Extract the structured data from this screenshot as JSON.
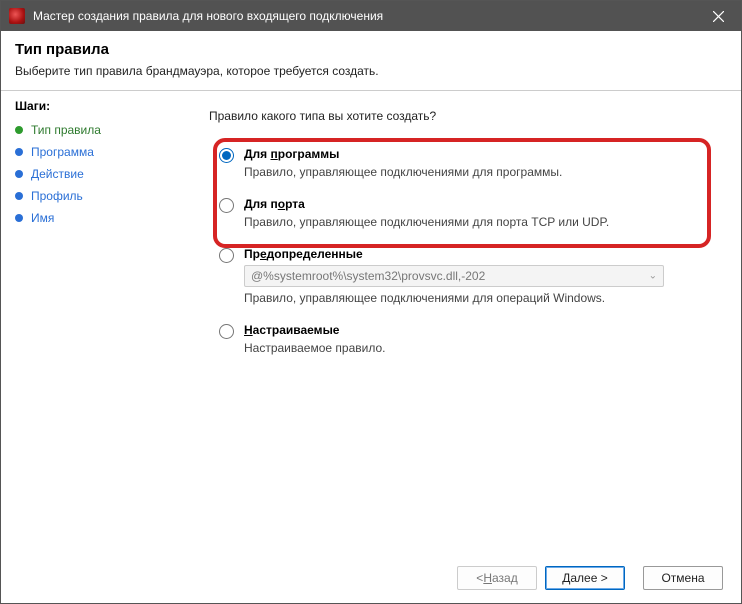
{
  "titlebar": {
    "title": "Мастер создания правила для нового входящего подключения"
  },
  "header": {
    "title": "Тип правила",
    "subtitle": "Выберите тип правила брандмауэра, которое требуется создать."
  },
  "steps": {
    "title": "Шаги:",
    "items": [
      {
        "label": "Тип правила",
        "color": "green",
        "active": true
      },
      {
        "label": "Программа",
        "color": "blue",
        "active": false
      },
      {
        "label": "Действие",
        "color": "blue",
        "active": false
      },
      {
        "label": "Профиль",
        "color": "blue",
        "active": false
      },
      {
        "label": "Имя",
        "color": "blue",
        "active": false
      }
    ]
  },
  "main": {
    "prompt": "Правило какого типа вы хотите создать?",
    "options": {
      "program": {
        "title_prefix": "Для ",
        "title_u": "п",
        "title_suffix": "рограммы",
        "desc": "Правило, управляющее подключениями для программы."
      },
      "port": {
        "title_prefix": "Для п",
        "title_u": "о",
        "title_suffix": "рта",
        "desc": "Правило, управляющее подключениями для порта TCP или UDP."
      },
      "predefined": {
        "title_prefix": "Пр",
        "title_u": "е",
        "title_suffix": "допределенные",
        "dropdown_value": "@%systemroot%\\system32\\provsvc.dll,-202",
        "desc": "Правило, управляющее подключениями для операций Windows."
      },
      "custom": {
        "title_u": "Н",
        "title_suffix": "астраиваемые",
        "desc": "Настраиваемое правило."
      }
    }
  },
  "footer": {
    "back_prefix": "< ",
    "back_u": "Н",
    "back_suffix": "азад",
    "next_u": "Д",
    "next_suffix": "алее >",
    "cancel": "Отмена"
  }
}
